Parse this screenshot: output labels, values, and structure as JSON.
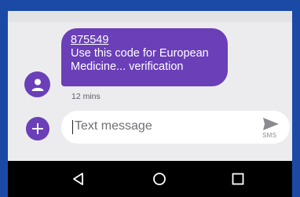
{
  "message": {
    "code": "875549",
    "line1": "Use this code for European",
    "line2": "Medicine... verification",
    "time": "12 mins"
  },
  "composer": {
    "placeholder": "Text message",
    "send_label": "SMS",
    "add_icon": "plus-icon",
    "send_icon": "send-icon"
  },
  "navigation": {
    "back_icon": "back-icon",
    "home_icon": "home-icon",
    "recents_icon": "recents-icon"
  },
  "colors": {
    "accent": "#6a3fb8",
    "background": "#ececef",
    "frame": "#1b4aa6",
    "nav_bar": "#000000"
  }
}
